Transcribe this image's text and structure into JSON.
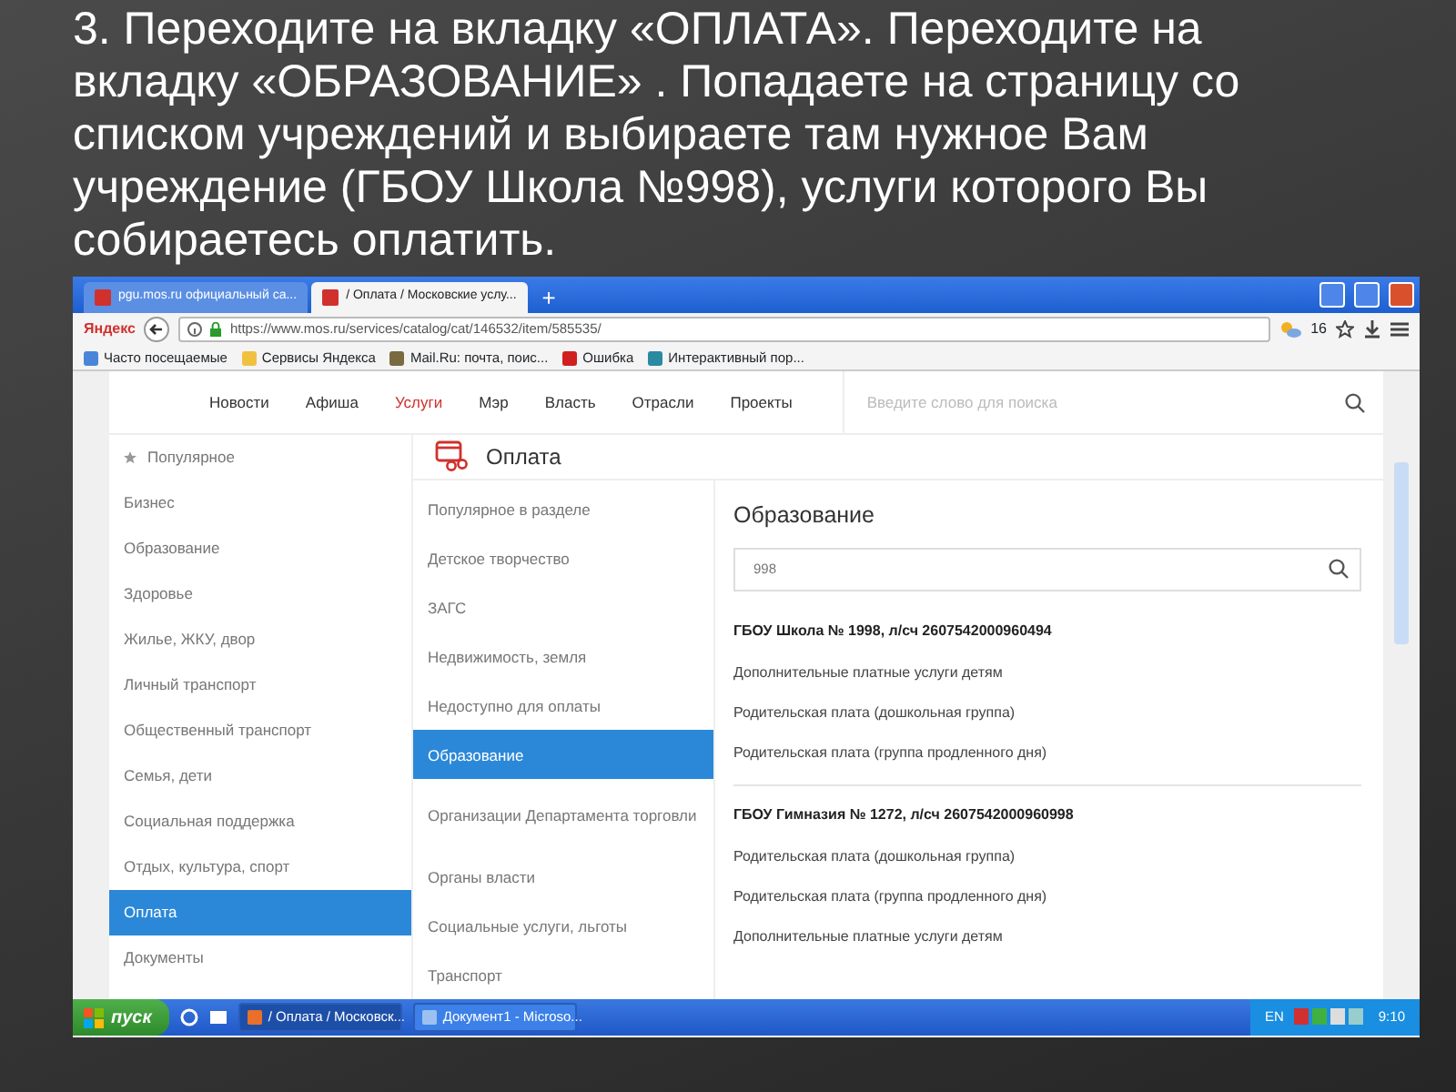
{
  "slide_title": "3. Переходите на вкладку «ОПЛАТА».  Переходите на вкладку «ОБРАЗОВАНИЕ» .  Попадаете на страницу со списком учреждений и выбираете там нужное Вам учреждение (ГБОУ Школа №998), услуги которого Вы собираетесь оплатить.",
  "browser": {
    "tabs": [
      {
        "label": "pgu.mos.ru официальный са...",
        "selected": false
      },
      {
        "label": "/ Оплата / Московские услу...",
        "selected": true
      }
    ],
    "new_tab": "+",
    "logo": "Яндекс",
    "url": "https://www.mos.ru/services/catalog/cat/146532/item/585535/",
    "weather": "16",
    "bookmarks": [
      "Часто посещаемые",
      "Сервисы Яндекса",
      "Mail.Ru: почта, поис...",
      "Ошибка",
      "Интерактивный пор..."
    ]
  },
  "site": {
    "nav": [
      {
        "label": "Новости",
        "selected": false
      },
      {
        "label": "Афиша",
        "selected": false
      },
      {
        "label": "Услуги",
        "selected": true
      },
      {
        "label": "Мэр",
        "selected": false
      },
      {
        "label": "Власть",
        "selected": false
      },
      {
        "label": "Отрасли",
        "selected": false
      },
      {
        "label": "Проекты",
        "selected": false
      }
    ],
    "search_placeholder": "Введите слово для поиска",
    "sidebar": [
      {
        "label": "Популярное",
        "selected": false
      },
      {
        "label": "Бизнес",
        "selected": false
      },
      {
        "label": "Образование",
        "selected": false
      },
      {
        "label": "Здоровье",
        "selected": false
      },
      {
        "label": "Жилье, ЖКУ, двор",
        "selected": false
      },
      {
        "label": "Личный транспорт",
        "selected": false
      },
      {
        "label": "Общественный транспорт",
        "selected": false
      },
      {
        "label": "Семья, дети",
        "selected": false
      },
      {
        "label": "Социальная поддержка",
        "selected": false
      },
      {
        "label": "Отдых, культура, спорт",
        "selected": false
      },
      {
        "label": "Оплата",
        "selected": true
      },
      {
        "label": "Документы",
        "selected": false
      }
    ],
    "section_title": "Оплата",
    "subsections": [
      {
        "label": "Популярное в разделе",
        "selected": false
      },
      {
        "label": "Детское творчество",
        "selected": false
      },
      {
        "label": "ЗАГС",
        "selected": false
      },
      {
        "label": "Недвижимость, земля",
        "selected": false
      },
      {
        "label": "Недоступно для оплаты",
        "selected": false
      },
      {
        "label": "Образование",
        "selected": true
      },
      {
        "label": "Организации Департамента торговли",
        "selected": false
      },
      {
        "label": "Органы власти",
        "selected": false
      },
      {
        "label": "Социальные услуги, льготы",
        "selected": false
      },
      {
        "label": "Транспорт",
        "selected": false
      }
    ],
    "panel": {
      "title": "Образование",
      "search_value": "998",
      "institutions": [
        {
          "name": "ГБОУ Школа № 1998, л/сч 2607542000960494",
          "services": [
            "Дополнительные платные услуги детям",
            "Родительская плата (дошкольная группа)",
            "Родительская плата (группа продленного дня)"
          ]
        },
        {
          "name": "ГБОУ Гимназия № 1272, л/сч 2607542000960998",
          "services": [
            "Родительская плата (дошкольная группа)",
            "Родительская плата (группа продленного дня)",
            "Дополнительные платные услуги детям"
          ]
        }
      ]
    }
  },
  "taskbar": {
    "start": "пуск",
    "tasks": [
      {
        "label": "/ Оплата / Московск...",
        "selected": true
      },
      {
        "label": "Документ1 - Microso...",
        "selected": false
      }
    ],
    "lang": "EN",
    "clock": "9:10"
  }
}
